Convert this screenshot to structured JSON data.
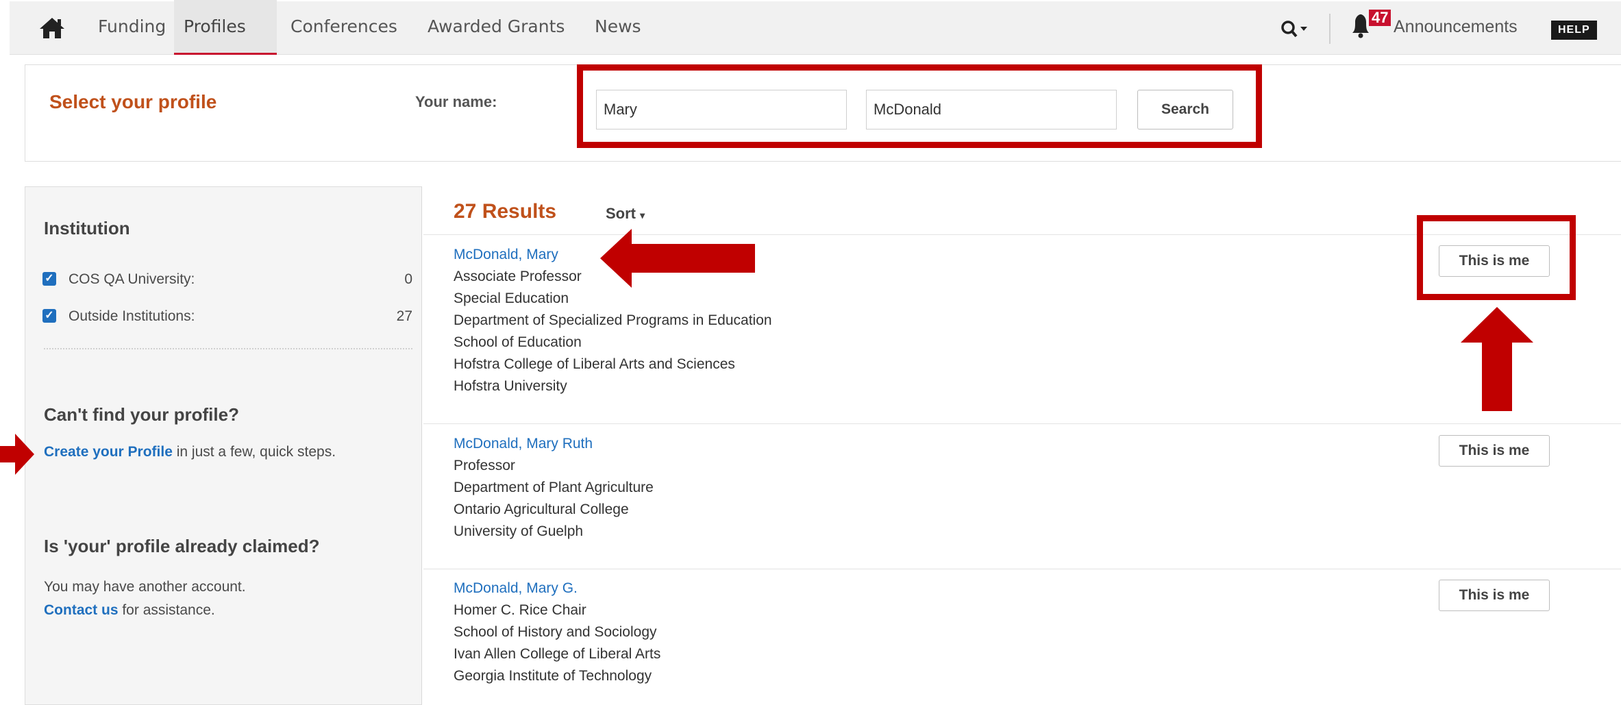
{
  "nav": {
    "links": [
      "Funding",
      "Profiles",
      "Conferences",
      "Awarded Grants",
      "News"
    ],
    "active": "Profiles",
    "announcements_count": "47",
    "announcements_label": "Announcements",
    "help_label": "HELP"
  },
  "select": {
    "title": "Select your profile",
    "name_label": "Your name:",
    "first_name": "Mary",
    "last_name": "McDonald",
    "search_label": "Search"
  },
  "sidebar": {
    "institution_heading": "Institution",
    "filters": [
      {
        "label": "COS QA University:",
        "count": "0",
        "checked": true
      },
      {
        "label": "Outside Institutions:",
        "count": "27",
        "checked": true
      }
    ],
    "cant_find_heading": "Can't find your profile?",
    "create_link": "Create your Profile",
    "create_rest": " in just a few, quick steps.",
    "claimed_heading": "Is 'your' profile already claimed?",
    "another_account": "You may have another account.",
    "contact_link": "Contact us",
    "contact_rest": " for assistance."
  },
  "results": {
    "count_label": "27 Results",
    "sort_label": "Sort",
    "button_label": "This is me",
    "items": [
      {
        "name": "McDonald, Mary",
        "lines": [
          "Associate Professor",
          "Special Education",
          "Department of Specialized Programs in Education",
          "School of Education",
          "Hofstra College of Liberal Arts and Sciences",
          "Hofstra University"
        ]
      },
      {
        "name": "McDonald, Mary Ruth",
        "lines": [
          "Professor",
          "Department of Plant Agriculture",
          "Ontario Agricultural College",
          "University of Guelph"
        ]
      },
      {
        "name": "McDonald, Mary G.",
        "lines": [
          "Homer C. Rice Chair",
          "School of History and Sociology",
          "Ivan Allen College of Liberal Arts",
          "Georgia Institute of Technology"
        ]
      }
    ]
  },
  "colors": {
    "accent_orange": "#c0511b",
    "link_blue": "#1f6fbe",
    "annotation_red": "#c00000"
  }
}
